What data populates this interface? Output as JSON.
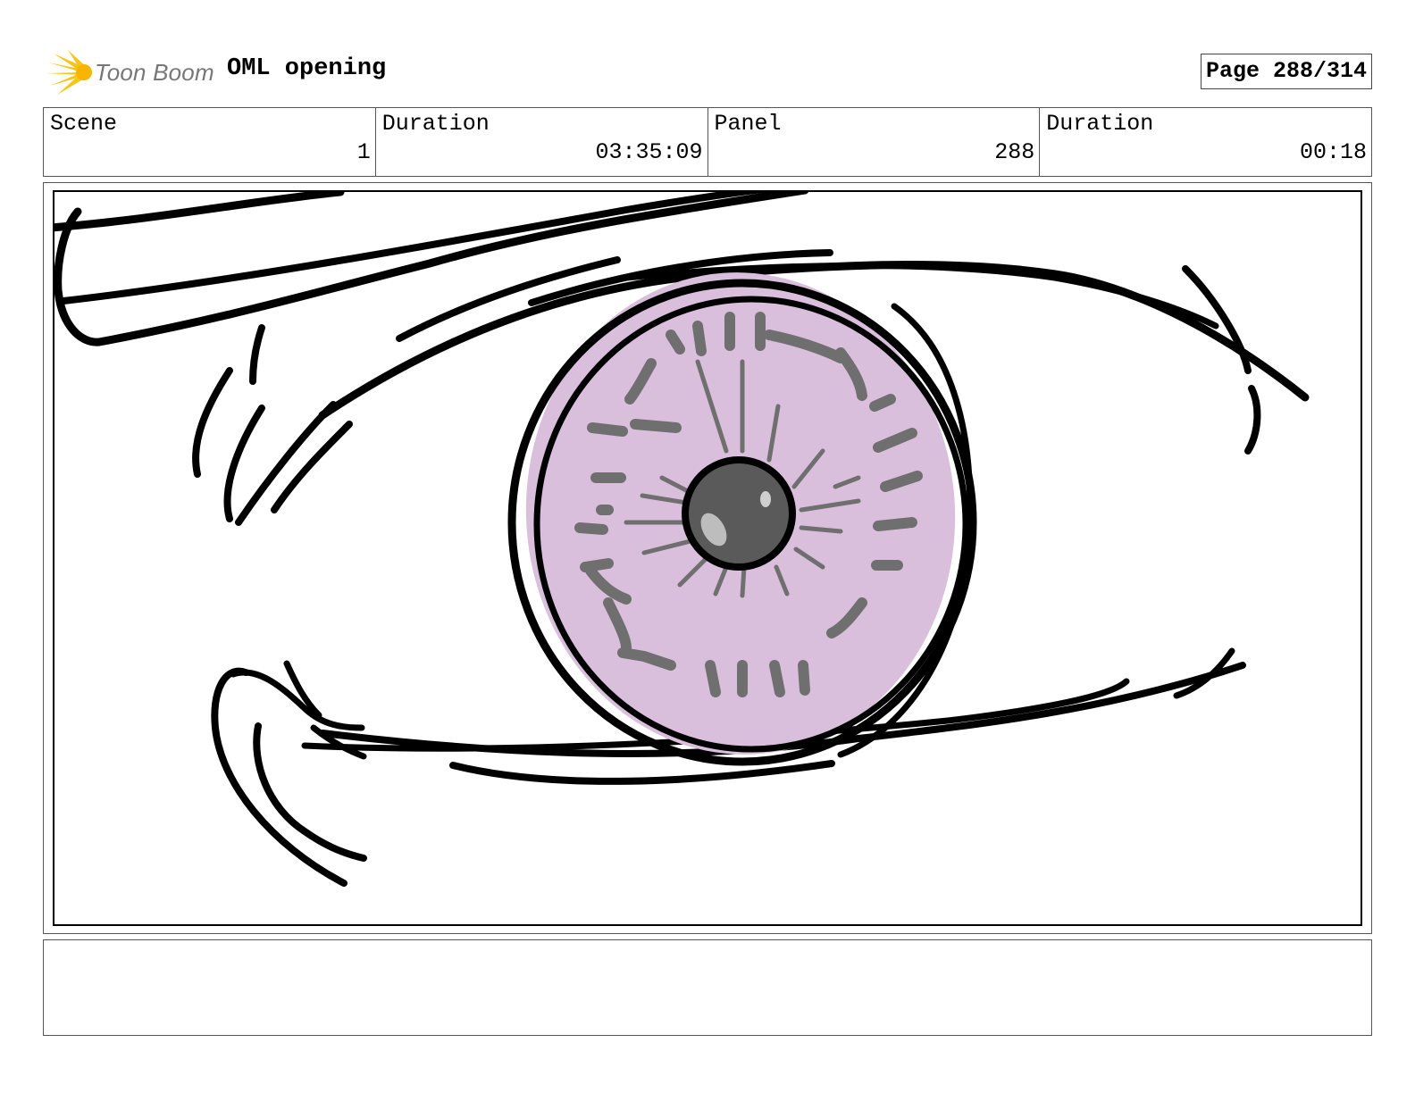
{
  "header": {
    "logo_text": "Toon Boom",
    "project_title": "OML opening",
    "page_label": "Page 288/314"
  },
  "info": {
    "scene_label": "Scene",
    "scene_value": "1",
    "scene_duration_label": "Duration",
    "scene_duration_value": "03:35:09",
    "panel_label": "Panel",
    "panel_value": "288",
    "panel_duration_label": "Duration",
    "panel_duration_value": "00:18"
  },
  "panel": {
    "image_subject": "eye-closeup-sketch",
    "colors": {
      "iris_fill": "#d9bfdc",
      "iris_marks": "#6f6f6f",
      "pupil": "#5a5a5a",
      "ink": "#000000"
    }
  },
  "notes": {
    "text": ""
  },
  "brand_colors": {
    "logo_star": "#f5c518",
    "logo_text": "#777777"
  }
}
